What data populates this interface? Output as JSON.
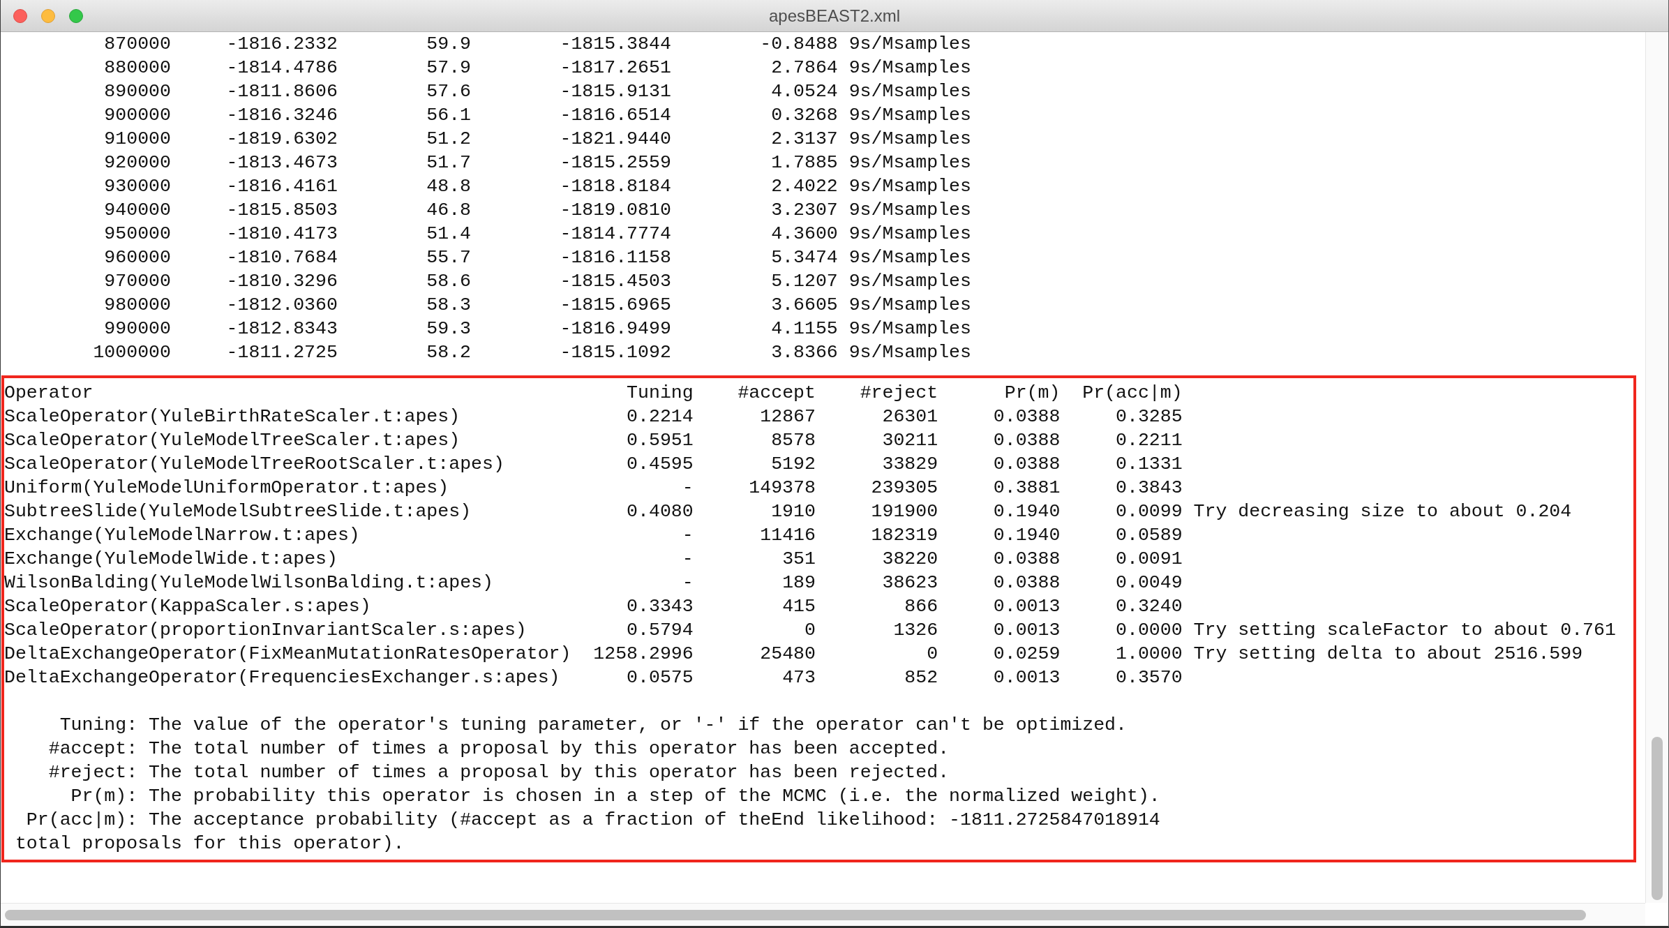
{
  "window": {
    "title": "apesBEAST2.xml"
  },
  "log": {
    "rows": [
      [
        "870000",
        "-1816.2332",
        "59.9",
        "-1815.3844",
        "-0.8488",
        "9s/Msamples"
      ],
      [
        "880000",
        "-1814.4786",
        "57.9",
        "-1817.2651",
        "2.7864",
        "9s/Msamples"
      ],
      [
        "890000",
        "-1811.8606",
        "57.6",
        "-1815.9131",
        "4.0524",
        "9s/Msamples"
      ],
      [
        "900000",
        "-1816.3246",
        "56.1",
        "-1816.6514",
        "0.3268",
        "9s/Msamples"
      ],
      [
        "910000",
        "-1819.6302",
        "51.2",
        "-1821.9440",
        "2.3137",
        "9s/Msamples"
      ],
      [
        "920000",
        "-1813.4673",
        "51.7",
        "-1815.2559",
        "1.7885",
        "9s/Msamples"
      ],
      [
        "930000",
        "-1816.4161",
        "48.8",
        "-1818.8184",
        "2.4022",
        "9s/Msamples"
      ],
      [
        "940000",
        "-1815.8503",
        "46.8",
        "-1819.0810",
        "3.2307",
        "9s/Msamples"
      ],
      [
        "950000",
        "-1810.4173",
        "51.4",
        "-1814.7774",
        "4.3600",
        "9s/Msamples"
      ],
      [
        "960000",
        "-1810.7684",
        "55.7",
        "-1816.1158",
        "5.3474",
        "9s/Msamples"
      ],
      [
        "970000",
        "-1810.3296",
        "58.6",
        "-1815.4503",
        "5.1207",
        "9s/Msamples"
      ],
      [
        "980000",
        "-1812.0360",
        "58.3",
        "-1815.6965",
        "3.6605",
        "9s/Msamples"
      ],
      [
        "990000",
        "-1812.8343",
        "59.3",
        "-1816.9499",
        "4.1155",
        "9s/Msamples"
      ],
      [
        "1000000",
        "-1811.2725",
        "58.2",
        "-1815.1092",
        "3.8366",
        "9s/Msamples"
      ]
    ]
  },
  "operators": {
    "columns": [
      "Operator",
      "Tuning",
      "#accept",
      "#reject",
      "Pr(m)",
      "Pr(acc|m)"
    ],
    "rows": [
      {
        "cells": [
          "ScaleOperator(YuleBirthRateScaler.t:apes)",
          "0.2214",
          "12867",
          "26301",
          "0.0388",
          "0.3285"
        ]
      },
      {
        "cells": [
          "ScaleOperator(YuleModelTreeScaler.t:apes)",
          "0.5951",
          "8578",
          "30211",
          "0.0388",
          "0.2211"
        ]
      },
      {
        "cells": [
          "ScaleOperator(YuleModelTreeRootScaler.t:apes)",
          "0.4595",
          "5192",
          "33829",
          "0.0388",
          "0.1331"
        ]
      },
      {
        "cells": [
          "Uniform(YuleModelUniformOperator.t:apes)",
          "-",
          "149378",
          "239305",
          "0.3881",
          "0.3843"
        ]
      },
      {
        "cells": [
          "SubtreeSlide(YuleModelSubtreeSlide.t:apes)",
          "0.4080",
          "1910",
          "191900",
          "0.1940",
          "0.0099"
        ],
        "note": "Try decreasing size to about 0.204"
      },
      {
        "cells": [
          "Exchange(YuleModelNarrow.t:apes)",
          "-",
          "11416",
          "182319",
          "0.1940",
          "0.0589"
        ]
      },
      {
        "cells": [
          "Exchange(YuleModelWide.t:apes)",
          "-",
          "351",
          "38220",
          "0.0388",
          "0.0091"
        ]
      },
      {
        "cells": [
          "WilsonBalding(YuleModelWilsonBalding.t:apes)",
          "-",
          "189",
          "38623",
          "0.0388",
          "0.0049"
        ]
      },
      {
        "cells": [
          "ScaleOperator(KappaScaler.s:apes)",
          "0.3343",
          "415",
          "866",
          "0.0013",
          "0.3240"
        ]
      },
      {
        "cells": [
          "ScaleOperator(proportionInvariantScaler.s:apes)",
          "0.5794",
          "0",
          "1326",
          "0.0013",
          "0.0000"
        ],
        "note": "Try setting scaleFactor to about 0.761"
      },
      {
        "cells": [
          "DeltaExchangeOperator(FixMeanMutationRatesOperator)",
          "1258.2996",
          "25480",
          "0",
          "0.0259",
          "1.0000"
        ],
        "note": "Try setting delta to about 2516.599"
      },
      {
        "cells": [
          "DeltaExchangeOperator(FrequenciesExchanger.s:apes)",
          "0.0575",
          "473",
          "852",
          "0.0013",
          "0.3570"
        ]
      }
    ]
  },
  "legend": [
    {
      "kind": "entry",
      "term": "Tuning:",
      "text": "The value of the operator's tuning parameter, or '-' if the operator can't be optimized."
    },
    {
      "kind": "entry",
      "term": "#accept:",
      "text": "The total number of times a proposal by this operator has been accepted."
    },
    {
      "kind": "entry",
      "term": "#reject:",
      "text": "The total number of times a proposal by this operator has been rejected."
    },
    {
      "kind": "entry",
      "term": "Pr(m):",
      "text": "The probability this operator is chosen in a step of the MCMC (i.e. the normalized weight)."
    },
    {
      "kind": "entry",
      "term": "Pr(acc|m):",
      "text": "The acceptance probability (#accept as a fraction of theEnd likelihood: -1811.2725847018914"
    },
    {
      "kind": "continuation",
      "text": "total proposals for this operator)."
    }
  ]
}
